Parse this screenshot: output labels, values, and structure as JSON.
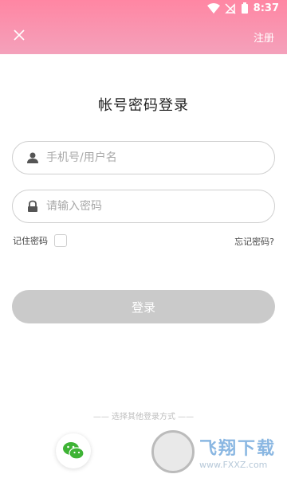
{
  "status_bar": {
    "time": "8:37"
  },
  "header": {
    "register_label": "注册"
  },
  "page": {
    "title": "帐号密码登录"
  },
  "form": {
    "username_placeholder": "手机号/用户名",
    "password_placeholder": "请输入密码",
    "remember_label": "记住密码",
    "forgot_label": "忘记密码?",
    "login_label": "登录"
  },
  "other_login": {
    "label": "—— 选择其他登录方式 ——"
  },
  "watermark": {
    "title": "飞翔下载",
    "url": "www.FXXZ.com"
  },
  "colors": {
    "header_gradient_top": "#ff86a3",
    "header_gradient_bottom": "#f4a1bb",
    "login_button": "#cacaca",
    "wechat_green": "#3eb335"
  }
}
